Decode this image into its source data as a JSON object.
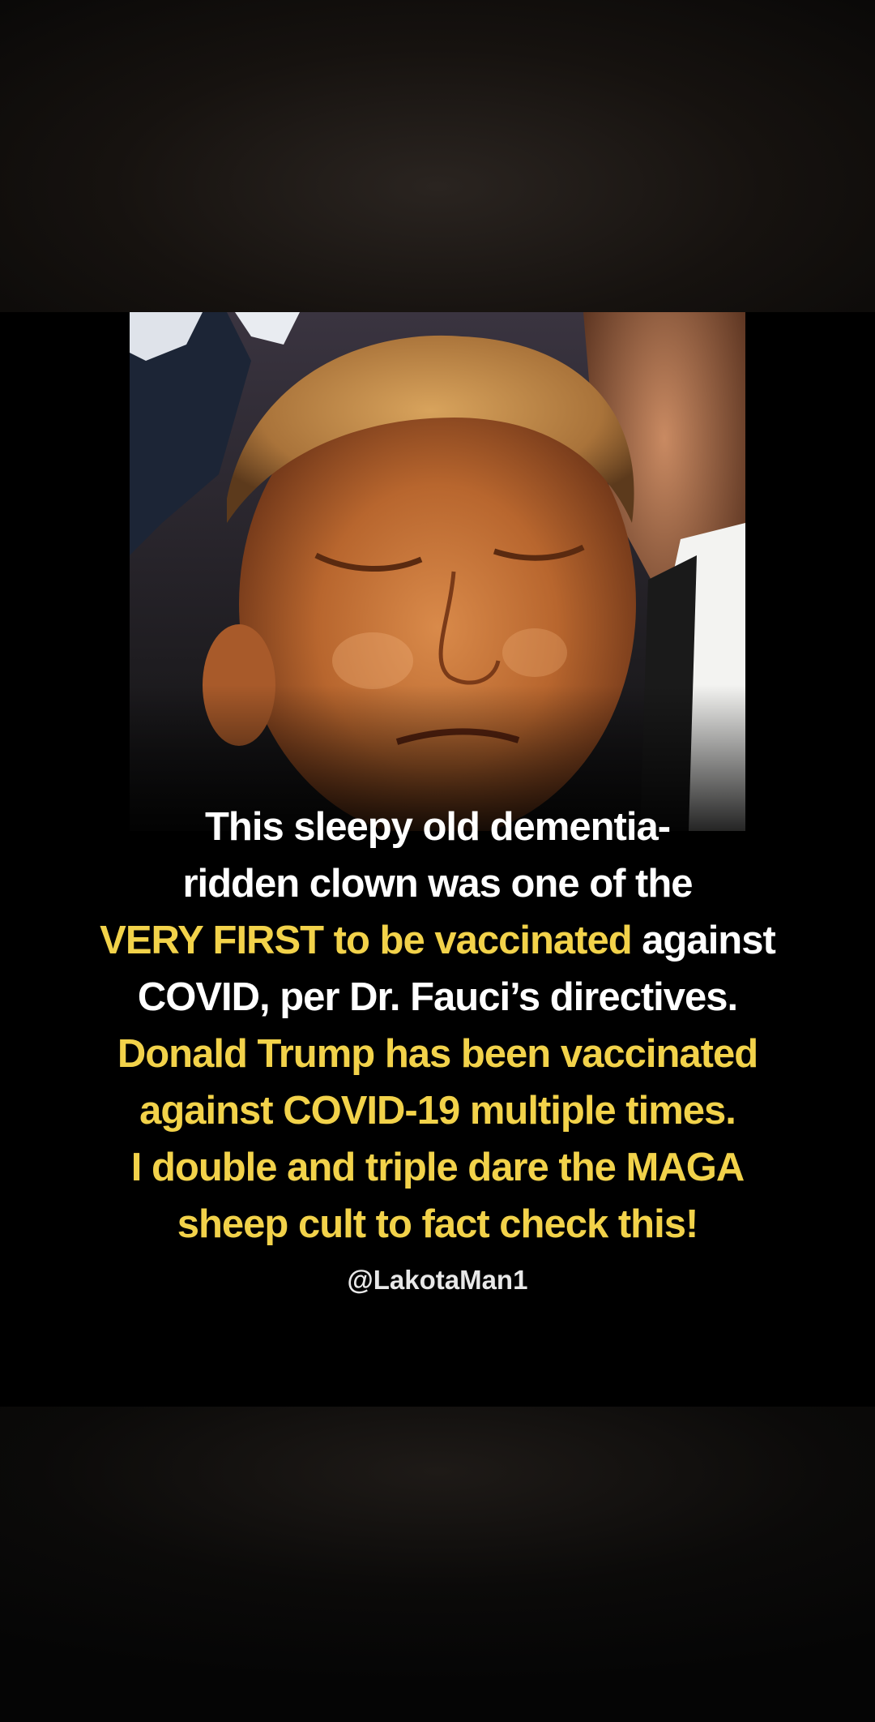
{
  "caption": {
    "line1": "This sleepy old dementia-",
    "line2": "ridden clown was one of the",
    "line3_yellow": "VERY FIRST to be vaccinated",
    "line3_white": " against",
    "line4": "COVID, per Dr. Fauci’s directives.",
    "line5": "Donald Trump has been vaccinated",
    "line6": "against COVID-19 multiple times.",
    "line7_white": "I double and triple dare the ",
    "line7_yellow": "MAGA",
    "line8": "sheep cult to fact check this!"
  },
  "handle": "@LakotaMan1",
  "colors": {
    "highlight": "#f2d24a",
    "text": "#ffffff",
    "background": "#000000"
  }
}
